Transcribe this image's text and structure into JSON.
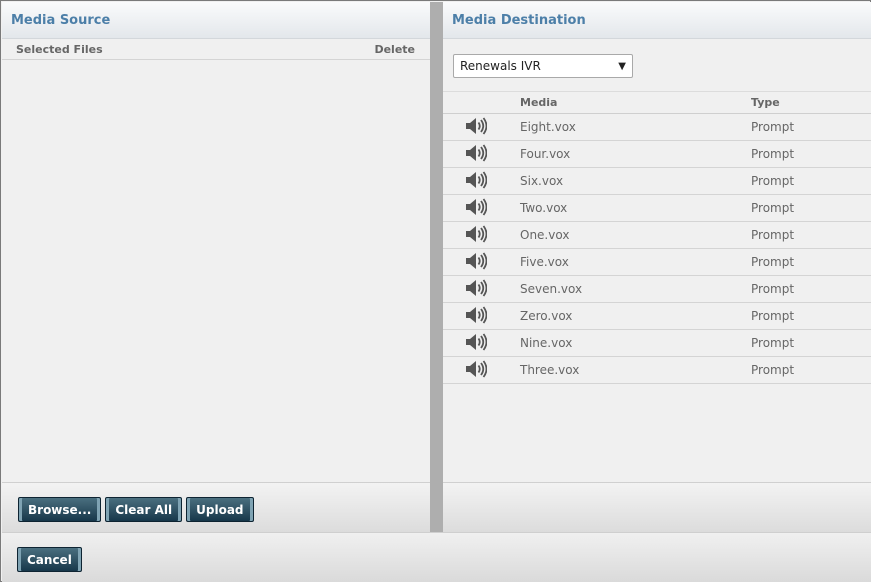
{
  "source": {
    "title": "Media Source",
    "col_selected": "Selected Files",
    "col_delete": "Delete",
    "buttons": {
      "browse": "Browse...",
      "clear_all": "Clear All",
      "upload": "Upload"
    }
  },
  "destination": {
    "title": "Media Destination",
    "selected_ivr": "Renewals IVR",
    "col_media": "Media",
    "col_type": "Type",
    "rows": [
      {
        "media": "Eight.vox",
        "type": "Prompt"
      },
      {
        "media": "Four.vox",
        "type": "Prompt"
      },
      {
        "media": "Six.vox",
        "type": "Prompt"
      },
      {
        "media": "Two.vox",
        "type": "Prompt"
      },
      {
        "media": "One.vox",
        "type": "Prompt"
      },
      {
        "media": "Five.vox",
        "type": "Prompt"
      },
      {
        "media": "Seven.vox",
        "type": "Prompt"
      },
      {
        "media": "Zero.vox",
        "type": "Prompt"
      },
      {
        "media": "Nine.vox",
        "type": "Prompt"
      },
      {
        "media": "Three.vox",
        "type": "Prompt"
      }
    ]
  },
  "footer": {
    "cancel": "Cancel"
  },
  "icons": {
    "row_icon": "speaker-icon",
    "select_icon": "dropdown-arrow-icon"
  },
  "colors": {
    "header_text": "#4c7fa8",
    "button_bg": "#1f4152"
  }
}
